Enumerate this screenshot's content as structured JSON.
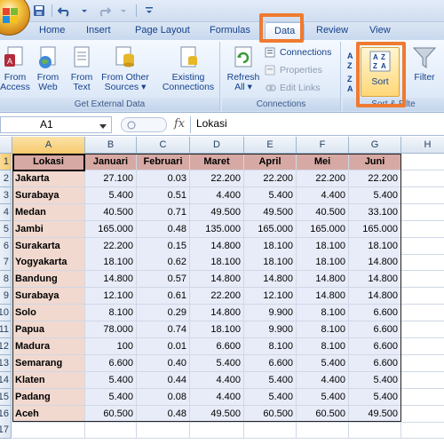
{
  "tabs": [
    {
      "label": "Home"
    },
    {
      "label": "Insert"
    },
    {
      "label": "Page Layout"
    },
    {
      "label": "Formulas"
    },
    {
      "label": "Data"
    },
    {
      "label": "Review"
    },
    {
      "label": "View"
    }
  ],
  "ribbon": {
    "get_external": {
      "label": "Get External Data",
      "access": [
        "From",
        "Access"
      ],
      "web": [
        "From",
        "Web"
      ],
      "text": [
        "From",
        "Text"
      ],
      "other": [
        "From Other",
        "Sources ▾"
      ],
      "existing": [
        "Existing",
        "Connections"
      ]
    },
    "connections": {
      "label": "Connections",
      "refresh": [
        "Refresh",
        "All ▾"
      ],
      "connections_btn": "Connections",
      "properties": "Properties",
      "edit_links": "Edit Links"
    },
    "sort_filter": {
      "label": "Sort & Filte",
      "sort": "Sort",
      "filter": "Filter"
    }
  },
  "formula_bar": {
    "name_box": "A1",
    "fx": "fx",
    "value": "Lokasi"
  },
  "columns": [
    "A",
    "B",
    "C",
    "D",
    "E",
    "F",
    "G",
    "H"
  ],
  "rows": [
    "1",
    "2",
    "3",
    "4",
    "5",
    "6",
    "7",
    "8",
    "9",
    "10",
    "11",
    "12",
    "13",
    "14",
    "15",
    "16",
    "17"
  ],
  "table": {
    "headers": [
      "Lokasi",
      "Januari",
      "Februari",
      "Maret",
      "April",
      "Mei",
      "Juni"
    ],
    "data": [
      [
        "Jakarta",
        "27.100",
        "0.03",
        "22.200",
        "22.200",
        "22.200",
        "22.200"
      ],
      [
        "Surabaya",
        "5.400",
        "0.51",
        "4.400",
        "5.400",
        "4.400",
        "5.400"
      ],
      [
        "Medan",
        "40.500",
        "0.71",
        "49.500",
        "49.500",
        "40.500",
        "33.100"
      ],
      [
        "Jambi",
        "165.000",
        "0.48",
        "135.000",
        "165.000",
        "165.000",
        "165.000"
      ],
      [
        "Surakarta",
        "22.200",
        "0.15",
        "14.800",
        "18.100",
        "18.100",
        "18.100"
      ],
      [
        "Yogyakarta",
        "18.100",
        "0.62",
        "18.100",
        "18.100",
        "18.100",
        "14.800"
      ],
      [
        "Bandung",
        "14.800",
        "0.57",
        "14.800",
        "14.800",
        "14.800",
        "14.800"
      ],
      [
        "Surabaya",
        "12.100",
        "0.61",
        "22.200",
        "12.100",
        "14.800",
        "14.800"
      ],
      [
        "Solo",
        "8.100",
        "0.29",
        "14.800",
        "9.900",
        "8.100",
        "6.600"
      ],
      [
        "Papua",
        "78.000",
        "0.74",
        "18.100",
        "9.900",
        "8.100",
        "6.600"
      ],
      [
        "Madura",
        "100",
        "0.01",
        "6.600",
        "8.100",
        "8.100",
        "6.600"
      ],
      [
        "Semarang",
        "6.600",
        "0.40",
        "5.400",
        "6.600",
        "5.400",
        "6.600"
      ],
      [
        "Klaten",
        "5.400",
        "0.44",
        "4.400",
        "5.400",
        "4.400",
        "5.400"
      ],
      [
        "Padang",
        "5.400",
        "0.08",
        "4.400",
        "5.400",
        "5.400",
        "5.400"
      ],
      [
        "Aceh",
        "60.500",
        "0.48",
        "49.500",
        "60.500",
        "60.500",
        "49.500"
      ]
    ]
  },
  "colors": {
    "highlight": "#ef7a30",
    "header_fill": "#d7a9a4",
    "label_fill": "#f1d9cf",
    "value_fill": "#e8ecf8"
  }
}
